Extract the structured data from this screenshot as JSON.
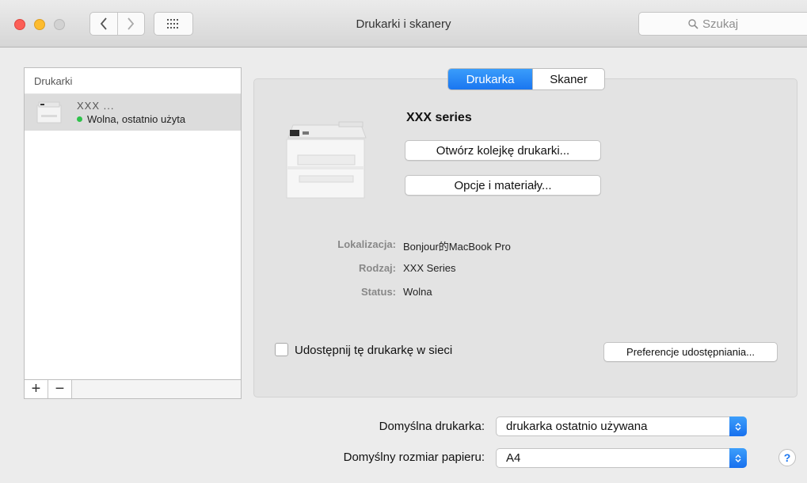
{
  "window": {
    "title": "Drukarki i skanery",
    "search_placeholder": "Szukaj"
  },
  "sidebar": {
    "header": "Drukarki",
    "add_label": "+",
    "remove_label": "−",
    "items": [
      {
        "name": "XXX ...",
        "status": "Wolna, ostatnio użyta",
        "status_color": "#2fc24b"
      }
    ]
  },
  "tabs": [
    {
      "label": "Drukarka",
      "active": true
    },
    {
      "label": "Skaner",
      "active": false
    }
  ],
  "printer": {
    "title": "XXX  series",
    "open_queue_button": "Otwórz kolejkę drukarki...",
    "options_button": "Opcje i materiały...",
    "info": [
      {
        "label": "Lokalizacja:",
        "value": "Bonjour的MacBook Pro"
      },
      {
        "label": "Rodzaj:",
        "value": "XXX Series"
      },
      {
        "label": "Status:",
        "value": "Wolna"
      }
    ],
    "share_checkbox_label": "Udostępnij tę drukarkę w sieci",
    "share_checked": false,
    "sharing_prefs_button": "Preferencje udostępniania..."
  },
  "defaults": {
    "printer_label": "Domyślna drukarka:",
    "printer_value": "drukarka ostatnio używana",
    "paper_label": "Domyślny rozmiar papieru:",
    "paper_value": "A4"
  },
  "help_label": "?",
  "colors": {
    "accent": "#1a76f0",
    "status_green": "#2fc24b"
  }
}
